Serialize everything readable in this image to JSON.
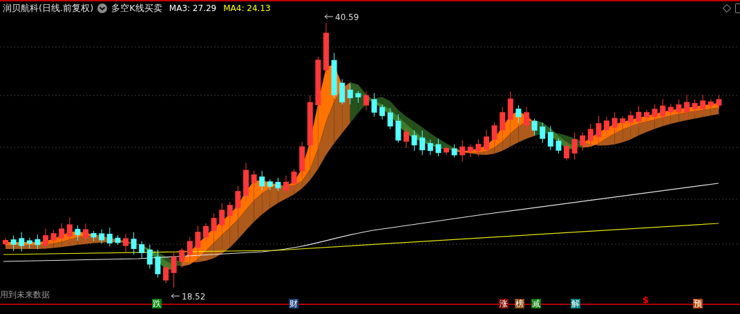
{
  "header": {
    "stock_title": "润贝航科(日线.前复权)",
    "indicator_name": "多空K线买卖",
    "indicators": [
      {
        "label": "MA3: 27.29",
        "color": "#ffffff"
      },
      {
        "label": "MA4: 24.13",
        "color": "#ffff00"
      }
    ]
  },
  "chart": {
    "high_label": "40.59",
    "low_label": "18.52",
    "note": "用到未来数据"
  },
  "markers": [
    {
      "kind": "badge",
      "text": "跌",
      "color": "#008000"
    },
    {
      "kind": "badge",
      "text": "财",
      "color": "#1a3f7a"
    },
    {
      "kind": "badge",
      "text": "涨",
      "color": "#800000"
    },
    {
      "kind": "badge",
      "text": "榜",
      "color": "#8b4a10"
    },
    {
      "kind": "badge",
      "text": "减",
      "color": "#0b7a0b"
    },
    {
      "kind": "badge",
      "text": "解",
      "color": "#008080"
    },
    {
      "kind": "symbol",
      "text": "$",
      "color": "#ff0000"
    },
    {
      "kind": "badge",
      "text": "预",
      "color": "#b5480e"
    }
  ]
}
